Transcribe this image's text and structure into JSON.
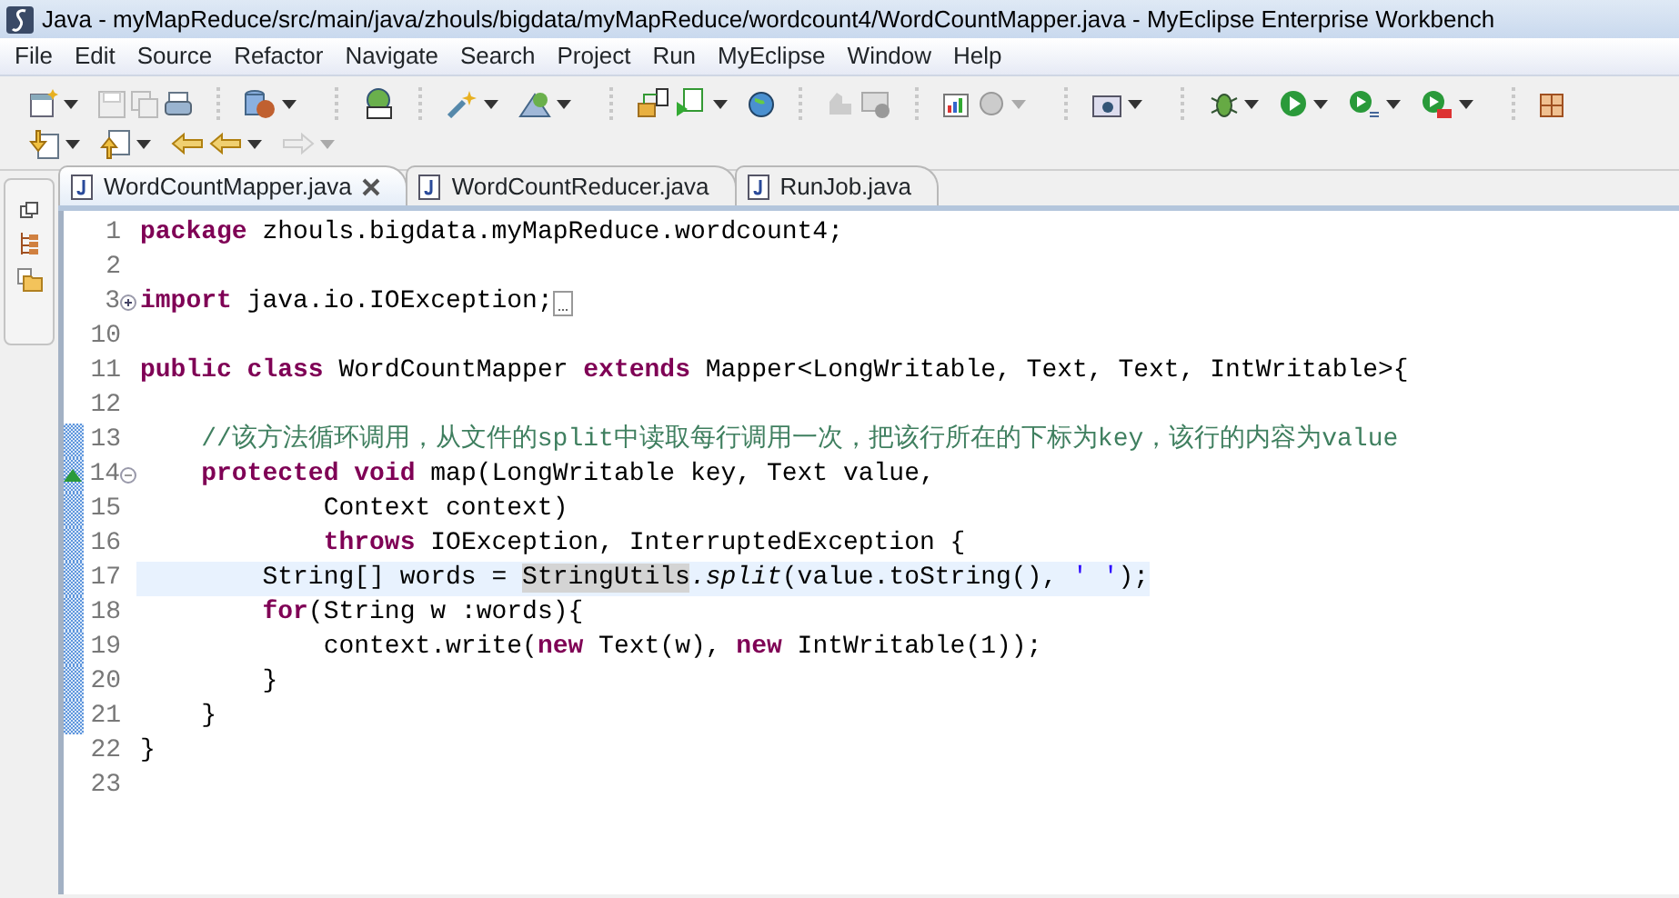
{
  "window": {
    "title": "Java - myMapReduce/src/main/java/zhouls/bigdata/myMapReduce/wordcount4/WordCountMapper.java - MyEclipse Enterprise Workbench"
  },
  "menu": [
    "File",
    "Edit",
    "Source",
    "Refactor",
    "Navigate",
    "Search",
    "Project",
    "Run",
    "MyEclipse",
    "Window",
    "Help"
  ],
  "tabs": [
    {
      "label": "WordCountMapper.java",
      "selected": true
    },
    {
      "label": "WordCountReducer.java",
      "selected": false
    },
    {
      "label": "RunJob.java",
      "selected": false
    }
  ],
  "editor": {
    "lines": [
      {
        "number": "1",
        "current": false,
        "range": false,
        "override": false,
        "tokens": [
          {
            "kind": "keyword",
            "text": "package"
          },
          {
            "kind": "plain",
            "text": " zhouls.bigdata.myMapReduce.wordcount4;"
          }
        ]
      },
      {
        "number": "2",
        "current": false,
        "range": false,
        "override": false
      },
      {
        "number": "3",
        "current": false,
        "range": false,
        "override": false,
        "collapsed": true,
        "tokens": [
          {
            "kind": "keyword",
            "text": "import"
          },
          {
            "kind": "plain",
            "text": " java.io.IOException;"
          }
        ]
      },
      {
        "number": "10",
        "current": false,
        "range": false,
        "override": false
      },
      {
        "number": "11",
        "current": false,
        "range": false,
        "override": false,
        "tokens": [
          {
            "kind": "keyword",
            "text": "public class"
          },
          {
            "kind": "plain",
            "text": " WordCountMapper "
          },
          {
            "kind": "keyword",
            "text": "extends"
          },
          {
            "kind": "plain",
            "text": " Mapper<LongWritable, Text, Text, IntWritable>{"
          }
        ]
      },
      {
        "number": "12",
        "current": false,
        "range": false,
        "override": false
      },
      {
        "number": "13",
        "current": false,
        "range": true,
        "override": false,
        "tokens": [
          {
            "kind": "comment",
            "text": "    //该方法循环调用，从文件的split中读取每行调用一次，把该行所在的下标为key，该行的内容为value"
          }
        ]
      },
      {
        "number": "14",
        "current": false,
        "range": true,
        "override": true,
        "collapsed": false,
        "tokens": [
          {
            "kind": "keyword",
            "text": "    protected void"
          },
          {
            "kind": "plain",
            "text": " map(LongWritable key, Text value,"
          }
        ]
      },
      {
        "number": "15",
        "current": false,
        "range": true,
        "override": false,
        "tokens": [
          {
            "kind": "plain",
            "text": "            Context context)"
          }
        ]
      },
      {
        "number": "16",
        "current": false,
        "range": true,
        "override": false,
        "tokens": [
          {
            "kind": "keyword",
            "text": "            throws"
          },
          {
            "kind": "plain",
            "text": " IOException, InterruptedException {"
          }
        ]
      },
      {
        "number": "17",
        "current": true,
        "range": true,
        "override": false,
        "tokens": [
          {
            "kind": "plain",
            "text": "        String[] words = "
          },
          {
            "kind": "occurrence",
            "text": "StringUtils"
          },
          {
            "kind": "static",
            "text": ".split"
          },
          {
            "kind": "plain",
            "text": "(value.toString(), "
          },
          {
            "kind": "string",
            "text": "' '"
          },
          {
            "kind": "plain",
            "text": ");"
          }
        ]
      },
      {
        "number": "18",
        "current": false,
        "range": true,
        "override": false,
        "tokens": [
          {
            "kind": "keyword",
            "text": "        for"
          },
          {
            "kind": "plain",
            "text": "(String w :words){"
          }
        ]
      },
      {
        "number": "19",
        "current": false,
        "range": true,
        "override": false,
        "tokens": [
          {
            "kind": "plain",
            "text": "            context.write("
          },
          {
            "kind": "keyword",
            "text": "new"
          },
          {
            "kind": "plain",
            "text": " Text(w), "
          },
          {
            "kind": "keyword",
            "text": "new"
          },
          {
            "kind": "plain",
            "text": " IntWritable(1));"
          }
        ]
      },
      {
        "number": "20",
        "current": false,
        "range": true,
        "override": false,
        "tokens": [
          {
            "kind": "plain",
            "text": "        }"
          }
        ]
      },
      {
        "number": "21",
        "current": false,
        "range": true,
        "override": false,
        "tokens": [
          {
            "kind": "plain",
            "text": "    }"
          }
        ]
      },
      {
        "number": "22",
        "current": false,
        "range": false,
        "override": false,
        "tokens": [
          {
            "kind": "plain",
            "text": "}"
          }
        ]
      },
      {
        "number": "23",
        "current": false,
        "range": false,
        "override": false
      }
    ]
  }
}
